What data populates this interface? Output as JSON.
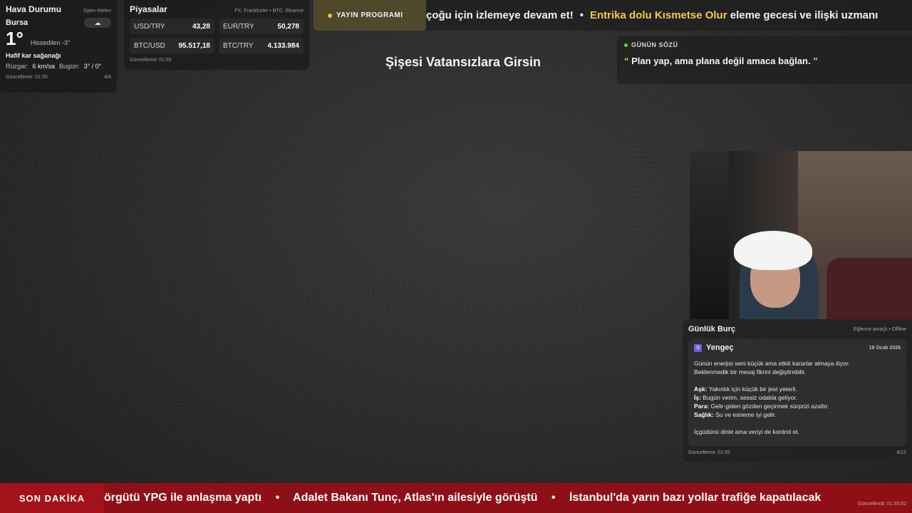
{
  "weather": {
    "title": "Hava Durumu",
    "source": "Open-Meteo",
    "city": "Bursa",
    "icon": "snow-cloud-icon",
    "icon_glyph": "☁",
    "temperature": "1°",
    "feels_like": "Hissedilen -3°",
    "condition": "Hafif kar sağanağı",
    "wind_label": "Rüzgar:",
    "wind_value": "6 km/sa",
    "today_label": "Bugün:",
    "today_value": "3° / 0°",
    "updated": "Güncelleme: 01:55",
    "page": "4/4"
  },
  "markets": {
    "title": "Piyasalar",
    "source": "FX: Frankfurter • BTC: Binance",
    "rates": [
      {
        "label": "USD/TRY",
        "value": "43,28"
      },
      {
        "label": "EUR/TRY",
        "value": "50,278"
      },
      {
        "label": "BTC/USD",
        "value": "95.517,18"
      },
      {
        "label": "BTC/TRY",
        "value": "4.133.984"
      }
    ],
    "updated": "Güncelleme: 01:55"
  },
  "schedule": {
    "label": "YAYIN PROGRAMI"
  },
  "top_ticker": {
    "text1": "çoğu için izlemeye devam et!",
    "separator": "•",
    "highlight": "Entrika dolu Kısmetse Olur",
    "text2": "eleme gecesi ve ilişki uzmanı"
  },
  "center_title": "Şişesi Vatansızlara Girsin",
  "quote": {
    "label": "GÜNÜN SÖZÜ",
    "open_mark": "“",
    "text": "Plan yap, ama plana değil amaca bağlan.",
    "close_mark": "”"
  },
  "horoscope": {
    "title": "Günlük Burç",
    "meta": "Eğlence amaçlı • Offline",
    "sign": "Yengeç",
    "sign_icon": "♋",
    "date": "19 Ocak 2026",
    "intro_1": "Günün enerjisi seni küçük ama etkili kararlar almaya itiyor.",
    "intro_2": "Beklenmedik bir mesaj fikrini değiştirebilir.",
    "love_label": "Aşk:",
    "love": "Yakınlık için küçük bir jest yeterli.",
    "work_label": "İş:",
    "work": "Bugün verim, sessiz odakla geliyor.",
    "money_label": "Para:",
    "money": "Gelir-gideri gözden geçirmek sürprizi azaltır.",
    "health_label": "Sağlık:",
    "health": "Su ve esneme iyi gelir.",
    "advice": "İçgüdünü dinle ama veriyi de kontrol et.",
    "updated": "Güncelleme: 01:55",
    "page": "4/12"
  },
  "breaking": {
    "label": "SON DAKİKA",
    "item1": "örgütü YPG ile anlaşma yaptı",
    "separator": "•",
    "item2": "Adalet Bakanı Tunç, Atlas'ın ailesiyle görüştü",
    "item3": "İstanbul'da yarın bazı yollar trafiğe kapatılacak",
    "updated": "Güncellendi: 01:55:02"
  }
}
